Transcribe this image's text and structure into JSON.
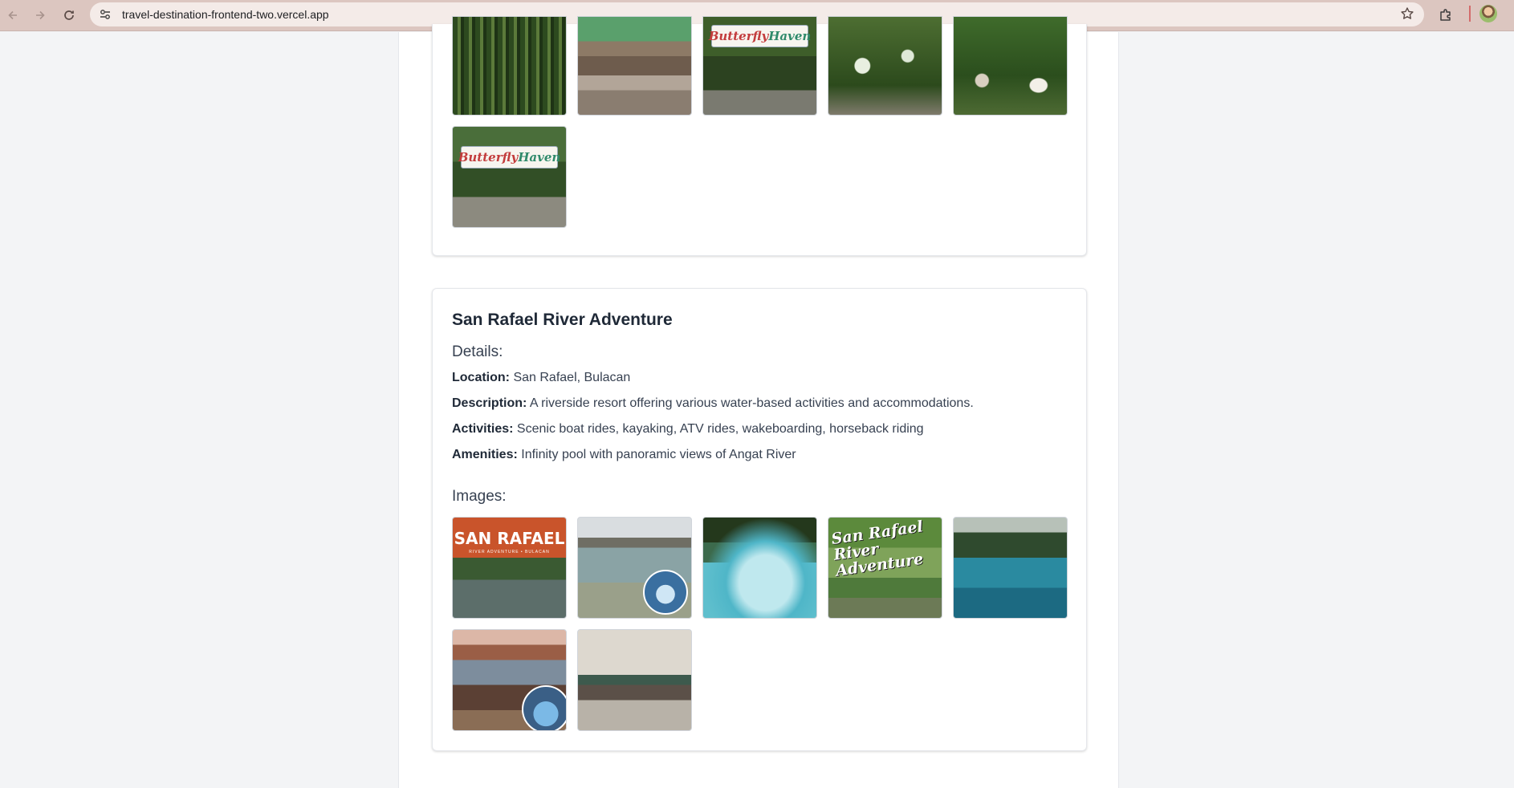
{
  "browser": {
    "url": "travel-destination-frontend-two.vercel.app"
  },
  "icons": {
    "back": "arrow-left-icon",
    "forward": "arrow-right-icon",
    "reload": "reload-icon",
    "site_info": "tune-icon",
    "bookmark": "star-icon",
    "extensions": "puzzle-icon",
    "profile": "avatar"
  },
  "previous_destination": {
    "images": [
      {
        "alt": "Bamboo walkway",
        "sign": ""
      },
      {
        "alt": "Wooden bridge",
        "sign": ""
      },
      {
        "alt": "Butterfly Haven entrance sign",
        "sign_a": "Butterfly",
        "sign_b": "Haven"
      },
      {
        "alt": "Garden path",
        "sign": ""
      },
      {
        "alt": "Child in garden",
        "sign": ""
      },
      {
        "alt": "Butterfly Haven gate",
        "sign_a": "Butterfly",
        "sign_b": "Haven"
      }
    ]
  },
  "destination": {
    "title": "San Rafael River Adventure",
    "details_label": "Details:",
    "location_label": "Location:",
    "location": "San Rafael, Bulacan",
    "description_label": "Description:",
    "description": "A riverside resort offering various water-based activities and accommodations.",
    "activities_label": "Activities:",
    "activities": "Scenic boat rides, kayaking, ATV rides, wakeboarding, horseback riding",
    "amenities_label": "Amenities:",
    "amenities": "Infinity pool with panoramic views of Angat River",
    "images_label": "Images:",
    "images": [
      {
        "alt": "San Rafael river aerial",
        "overlay": "SAN RAFAEL",
        "overlay_sub": "RIVER ADVENTURE • BULACAN"
      },
      {
        "alt": "Glass cabin"
      },
      {
        "alt": "Infinity pool"
      },
      {
        "alt": "San Rafael River Adventure poster",
        "overlay_a": "San Rafael",
        "overlay_b": "River Adventure"
      },
      {
        "alt": "River with trees"
      },
      {
        "alt": "Glass house lodge"
      },
      {
        "alt": "Floating cottage"
      }
    ]
  }
}
